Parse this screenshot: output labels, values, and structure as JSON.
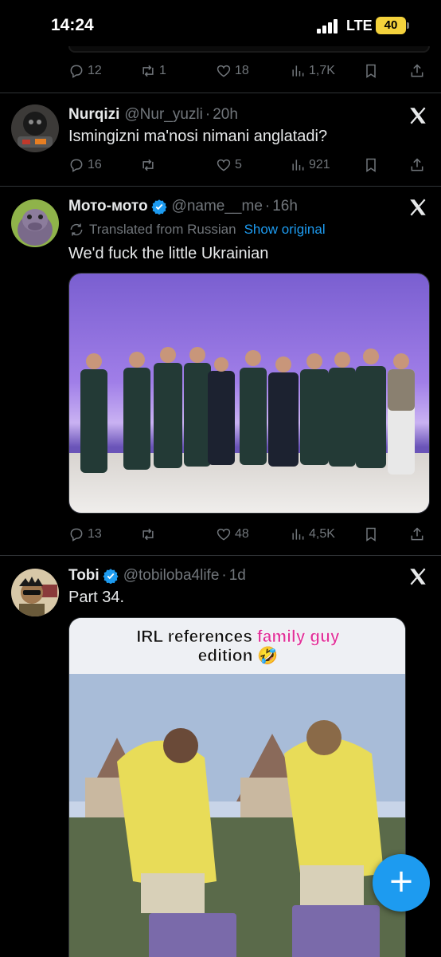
{
  "status_bar": {
    "time": "14:24",
    "network": "LTE",
    "battery": "40"
  },
  "colors": {
    "accent": "#1d9bf0",
    "muted": "#71767b",
    "battery": "#f4d23c"
  },
  "tweets": [
    {
      "partial": true,
      "actions": {
        "replies": "12",
        "retweets": "1",
        "likes": "18",
        "views": "1,7K"
      }
    },
    {
      "name": "Nurqizi",
      "handle": "@Nur_yuzli",
      "time": "20h",
      "verified": false,
      "text": "Ismingizni ma'nosi nimani anglatadi?",
      "actions": {
        "replies": "16",
        "retweets": "",
        "likes": "5",
        "views": "921"
      }
    },
    {
      "name": "Мото-мото",
      "handle": "@name__me",
      "time": "16h",
      "verified": true,
      "translated_label": "Translated from Russian",
      "show_original": "Show original",
      "text": "We'd fuck the little Ukrainian",
      "media": "group-photo",
      "actions": {
        "replies": "13",
        "retweets": "",
        "likes": "48",
        "views": "4,5K"
      }
    },
    {
      "name": "Tobi",
      "handle": "@tobiloba4life",
      "time": "1d",
      "verified": true,
      "text": "Part 34.",
      "media": "video",
      "media_caption": {
        "line1_a": "IRL references ",
        "line1_b": "family guy",
        "line2": "edition 🤣"
      }
    }
  ],
  "icons": {
    "reply": "reply-icon",
    "retweet": "retweet-icon",
    "like": "heart-icon",
    "views": "views-icon",
    "bookmark": "bookmark-icon",
    "share": "share-icon",
    "more": "x-logo-icon",
    "compose": "plus-icon"
  }
}
